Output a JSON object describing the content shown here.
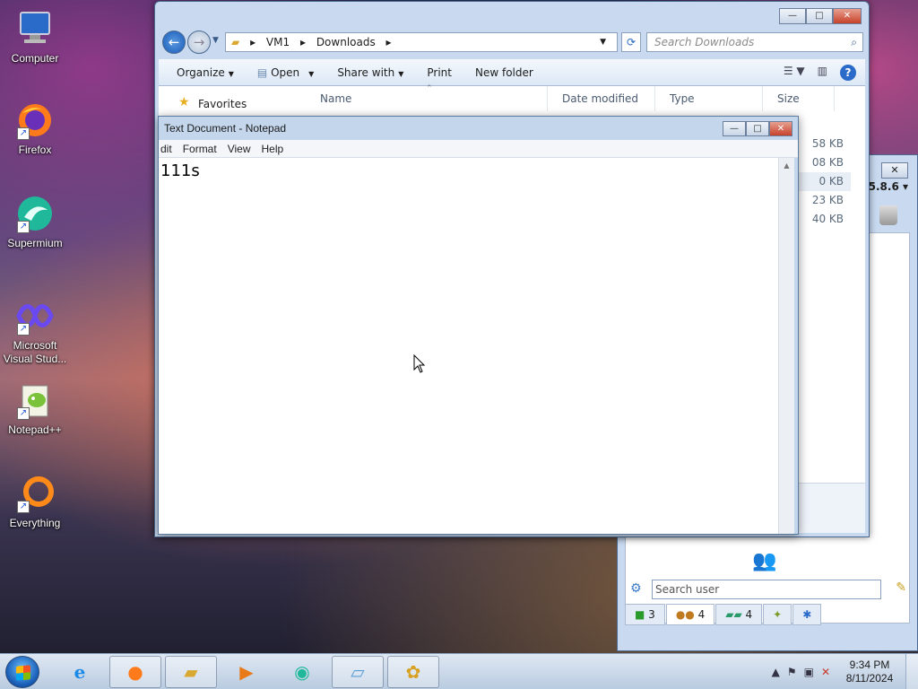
{
  "desktop": {
    "icons": [
      {
        "label": "Computer"
      },
      {
        "label": "Firefox"
      },
      {
        "label": "Supermium"
      },
      {
        "label": "Microsoft Visual Stud..."
      },
      {
        "label": "Notepad++"
      },
      {
        "label": "Everything"
      }
    ]
  },
  "explorer": {
    "breadcrumb": [
      "VM1",
      "Downloads"
    ],
    "search_placeholder": "Search Downloads",
    "toolbar": {
      "organize": "Organize",
      "open": "Open",
      "share_with": "Share with",
      "print": "Print",
      "new_folder": "New folder"
    },
    "nav_favorites": "Favorites",
    "columns": [
      "Name",
      "Date modified",
      "Type",
      "Size"
    ],
    "sizes": [
      "58 KB",
      "08 KB",
      "0 KB",
      "23 KB",
      "40 KB"
    ]
  },
  "notepad": {
    "title": "Text Document - Notepad",
    "menu": [
      "dit",
      "Format",
      "View",
      "Help"
    ],
    "content": "111s"
  },
  "chat": {
    "version": "5.8.6",
    "search_placeholder": "Search user",
    "tabs": [
      {
        "icon": "monitor-icon",
        "count": "3"
      },
      {
        "icon": "users-icon",
        "count": "4"
      },
      {
        "icon": "chat-icon",
        "count": "4"
      },
      {
        "icon": "group-icon",
        "count": ""
      },
      {
        "icon": "pin-icon",
        "count": ""
      }
    ]
  },
  "taskbar": {
    "time": "9:34 PM",
    "date": "8/11/2024"
  }
}
